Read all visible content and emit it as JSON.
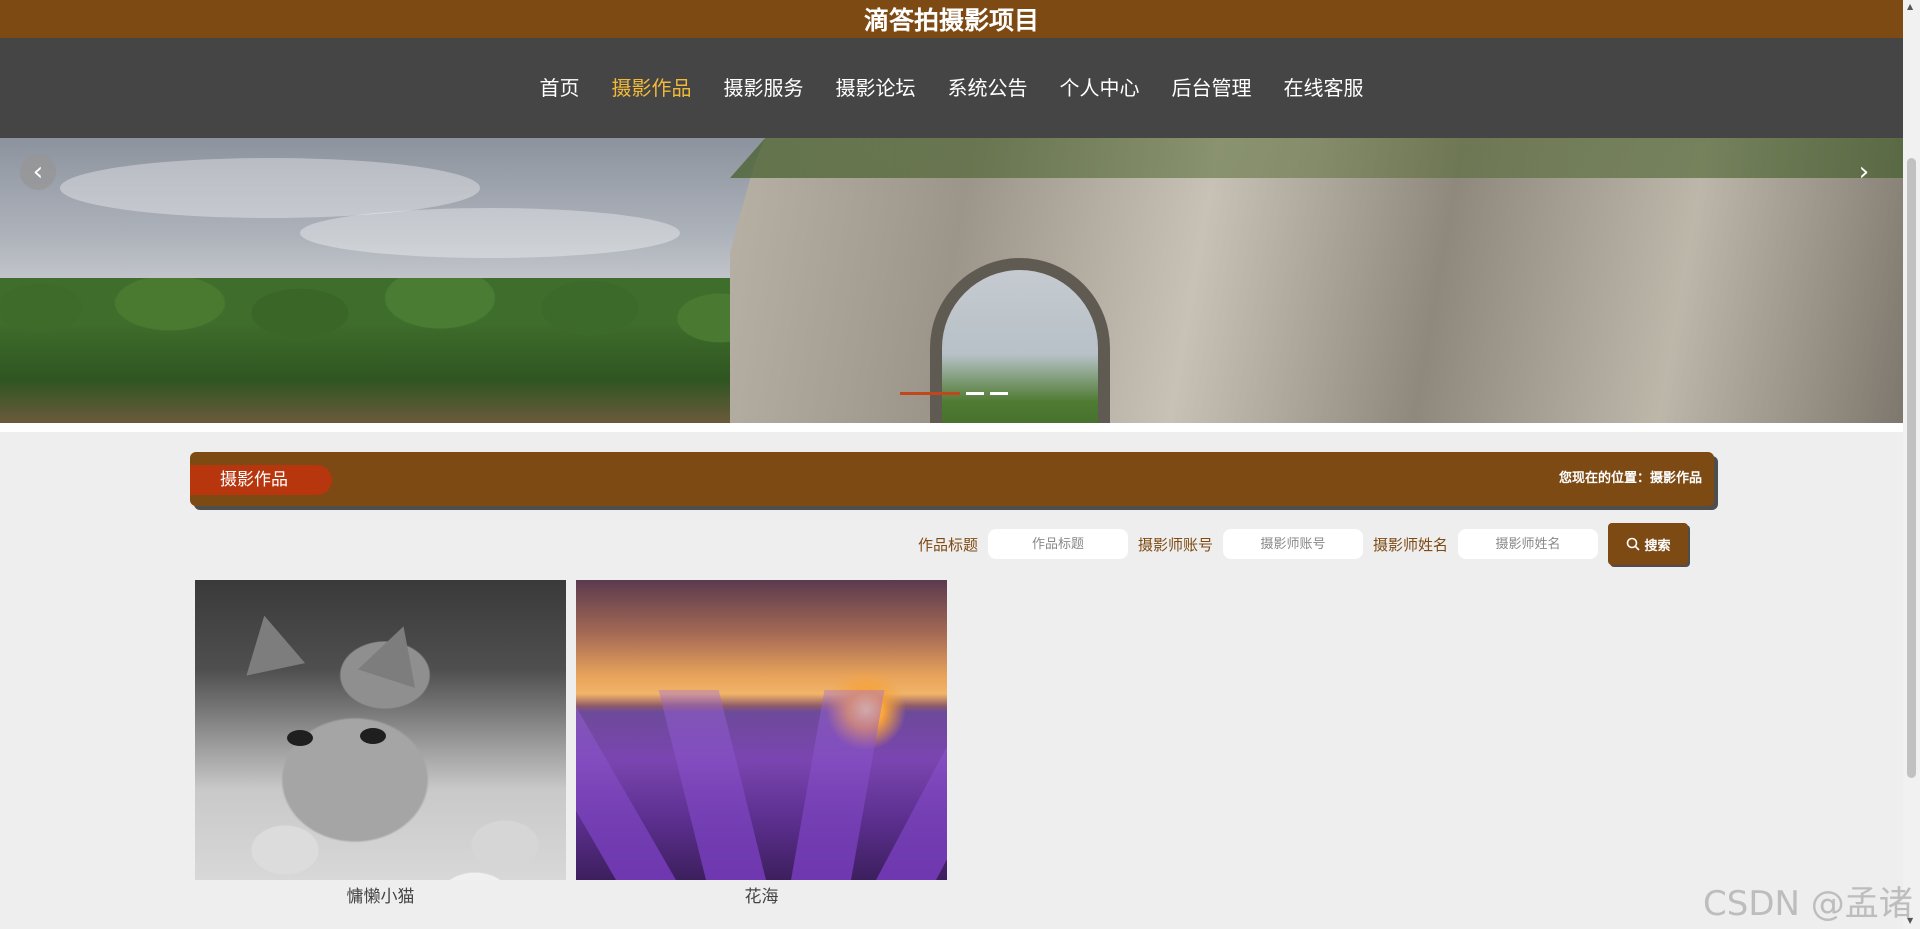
{
  "site": {
    "title": "滴答拍摄影项目"
  },
  "nav": {
    "items": [
      {
        "label": "首页",
        "active": false
      },
      {
        "label": "摄影作品",
        "active": true
      },
      {
        "label": "摄影服务",
        "active": false
      },
      {
        "label": "摄影论坛",
        "active": false
      },
      {
        "label": "系统公告",
        "active": false
      },
      {
        "label": "个人中心",
        "active": false
      },
      {
        "label": "后台管理",
        "active": false
      },
      {
        "label": "在线客服",
        "active": false
      }
    ],
    "active_color": "#f1b93a"
  },
  "banner": {
    "prev_icon": "chevron-left-icon",
    "next_icon": "chevron-right-icon",
    "prev_glyph": "‹",
    "next_glyph": "›",
    "dot_count": 3,
    "active_dot": 0
  },
  "section": {
    "title": "摄影作品",
    "breadcrumb": "您现在的位置：摄影作品"
  },
  "search": {
    "fields": [
      {
        "label": "作品标题",
        "placeholder": "作品标题"
      },
      {
        "label": "摄影师账号",
        "placeholder": "摄影师账号"
      },
      {
        "label": "摄影师姓名",
        "placeholder": "摄影师姓名"
      }
    ],
    "button_label": "搜索"
  },
  "works": [
    {
      "title": "慵懒小猫"
    },
    {
      "title": "花海"
    }
  ],
  "watermark": "CSDN @孟诸",
  "colors": {
    "brand_brown": "#7e4a14",
    "nav_bg": "#454545",
    "pill_red": "#b7360e",
    "page_bg": "#eeeeee"
  }
}
